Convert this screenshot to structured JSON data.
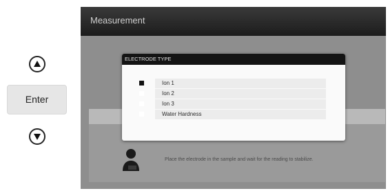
{
  "controls": {
    "enter_label": "Enter"
  },
  "screen": {
    "title": "Measurement",
    "hint": "Place the electrode in the sample and wait for the reading to stabilize."
  },
  "dialog": {
    "title": "ELECTRODE TYPE",
    "options": [
      {
        "label": "Ion 1",
        "selected": true
      },
      {
        "label": "Ion 2",
        "selected": false
      },
      {
        "label": "Ion 3",
        "selected": false
      },
      {
        "label": "Water Hardness",
        "selected": false
      }
    ]
  },
  "colors": {
    "header": "#1c1c1c",
    "screen_bg": "#8e8e8e",
    "dialog_bg": "#fafafa"
  }
}
